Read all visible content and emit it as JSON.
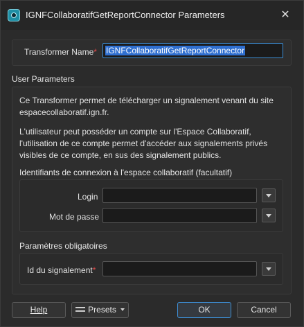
{
  "window": {
    "title": "IGNFCollaboratifGetReportConnector Parameters",
    "close_glyph": "✕"
  },
  "transformer": {
    "label": "Transformer Name",
    "required_marker": "*",
    "value": "IGNFCollaboratifGetReportConnector"
  },
  "user_parameters": {
    "title": "User Parameters",
    "description_1_line_1": "Ce Transformer permet de télécharger un signalement venant du site",
    "description_1_line_2": "espacecollaboratif.ign.fr.",
    "description_2_line_1": "L'utilisateur peut posséder un compte sur l'Espace Collaboratif,",
    "description_2_line_2": "l'utilisation de ce compte permet d'accéder aux signalements privés",
    "description_2_line_3": "visibles de ce compte, en sus des signalement publics.",
    "credentials_title": "Identifiants de connexion à l'espace collaboratif (facultatif)",
    "login_label": "Login",
    "login_value": "",
    "password_label": "Mot de passe",
    "password_value": "",
    "mandatory_title": "Paramètres obligatoires",
    "report_id_label": "Id du signalement",
    "report_id_required_marker": "*",
    "report_id_value": ""
  },
  "buttons": {
    "help": "Help",
    "presets": "Presets",
    "ok": "OK",
    "cancel": "Cancel"
  },
  "icons": {
    "app": "fme-transformer-icon",
    "close": "close-icon",
    "dropdown": "chevron-down-icon",
    "presets": "list-icon"
  },
  "colors": {
    "focus_accent": "#3d8fd6",
    "required": "#e04a4a",
    "selection": "#2f6fd0"
  }
}
